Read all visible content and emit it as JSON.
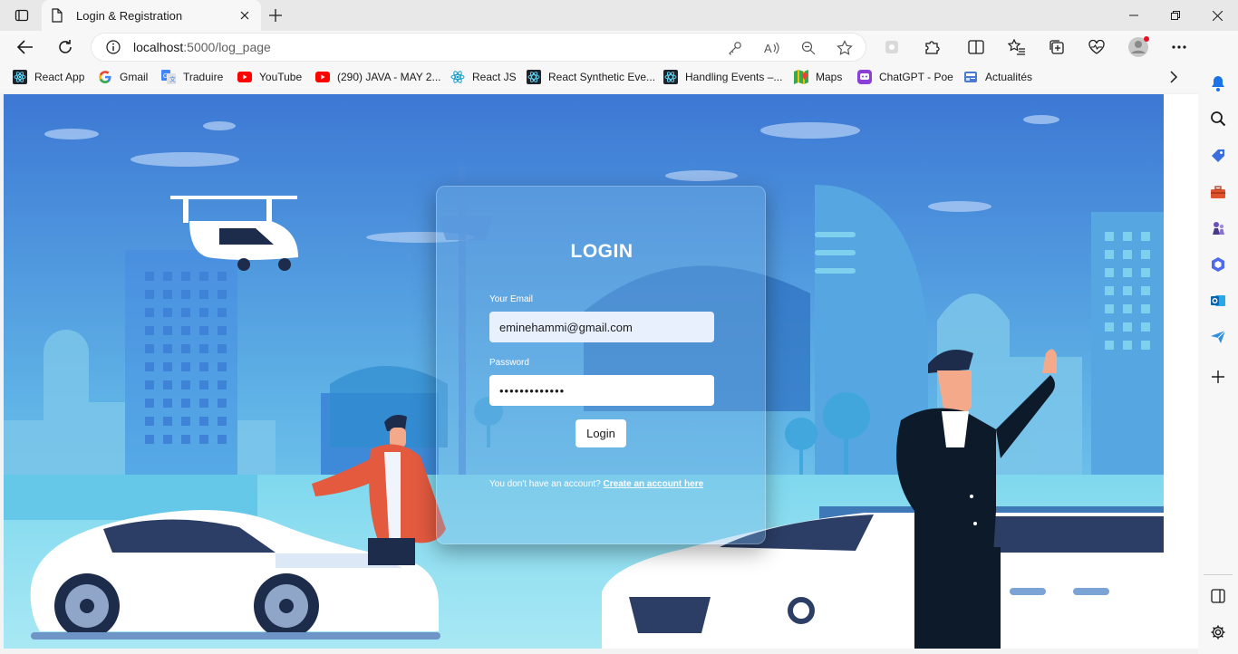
{
  "browser": {
    "tab_title": "Login & Registration",
    "url_host": "localhost",
    "url_rest": ":5000/log_page"
  },
  "bookmarks": [
    {
      "label": "React App",
      "icon": "react-icon"
    },
    {
      "label": "Gmail",
      "icon": "google-icon"
    },
    {
      "label": "Traduire",
      "icon": "translate-icon"
    },
    {
      "label": "YouTube",
      "icon": "youtube-icon"
    },
    {
      "label": "(290) JAVA - MAY 2...",
      "icon": "youtube-icon"
    },
    {
      "label": "React JS",
      "icon": "react-icon"
    },
    {
      "label": "React Synthetic Eve...",
      "icon": "react-dark-icon"
    },
    {
      "label": "Handling Events –...",
      "icon": "react-dark-icon"
    },
    {
      "label": "Maps",
      "icon": "maps-icon"
    },
    {
      "label": "ChatGPT - Poe",
      "icon": "poe-icon"
    },
    {
      "label": "Actualités",
      "icon": "news-icon"
    }
  ],
  "login": {
    "title": "LOGIN",
    "email_label": "Your Email",
    "email_value": "eminehammi@gmail.com",
    "password_label": "Password",
    "password_value": "•••••••••••••",
    "button_label": "Login",
    "register_prompt": "You don't have an account? ",
    "register_link": "Create an account here"
  },
  "colors": {
    "sky_top": "#3f7ad6",
    "sky_bottom": "#7fd3ec",
    "accent_blue": "#0067c0"
  }
}
